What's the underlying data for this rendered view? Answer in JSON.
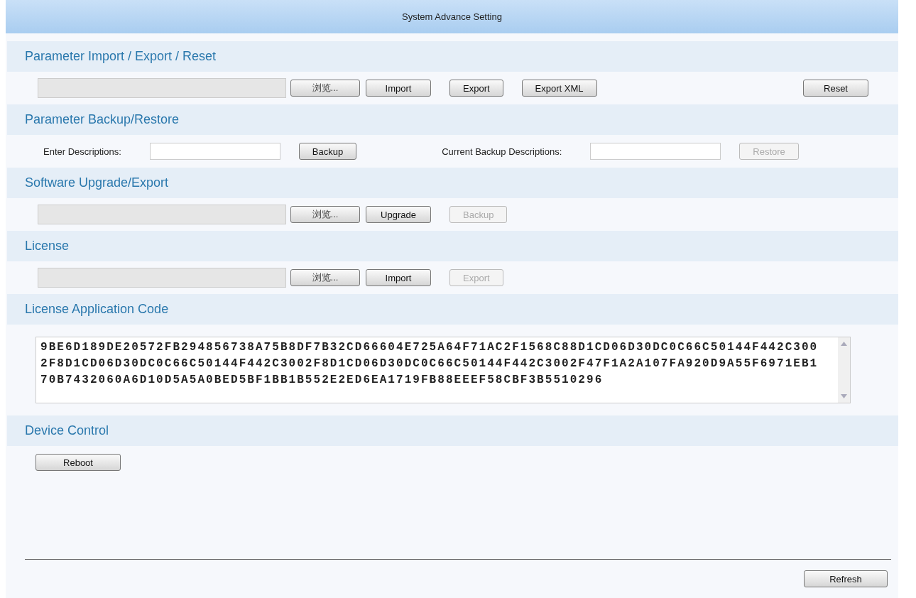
{
  "window": {
    "title": "System Advance Setting"
  },
  "sections": [
    {
      "title": "Parameter Import / Export / Reset",
      "items": [
        {
          "kind": "file",
          "browse": "浏览..."
        },
        {
          "kind": "button",
          "label": "Import",
          "disabled": false
        },
        {
          "kind": "button",
          "label": "Export",
          "disabled": false
        },
        {
          "kind": "button",
          "label": "Export XML",
          "disabled": false
        },
        {
          "kind": "button",
          "label": "Reset",
          "disabled": false
        }
      ]
    },
    {
      "title": "Parameter Backup/Restore",
      "items": [
        {
          "kind": "label",
          "text": "Enter Descriptions:"
        },
        {
          "kind": "input"
        },
        {
          "kind": "button",
          "label": "Backup",
          "disabled": false
        },
        {
          "kind": "label",
          "text": "Current Backup Descriptions:"
        },
        {
          "kind": "input"
        },
        {
          "kind": "button",
          "label": "Restore",
          "disabled": true
        }
      ]
    },
    {
      "title": "Software Upgrade/Export",
      "items": [
        {
          "kind": "file",
          "browse": "浏览..."
        },
        {
          "kind": "button",
          "label": "Upgrade",
          "disabled": false
        },
        {
          "kind": "button",
          "label": "Backup",
          "disabled": true
        }
      ]
    },
    {
      "title": "License",
      "items": [
        {
          "kind": "file",
          "browse": "浏览..."
        },
        {
          "kind": "button",
          "label": "Import",
          "disabled": false
        },
        {
          "kind": "button",
          "label": "Export",
          "disabled": true
        }
      ]
    },
    {
      "title": "License Application Code",
      "items": [
        {
          "kind": "textarea",
          "value": "9BE6D189DE20572FB294856738A75B8DF7B32CD66604E725A64F71AC2F1568C88D1CD06D30DC0C66C50144F442C3002F8D1CD06D30DC0C66C50144F442C3002F8D1CD06D30DC0C66C50144F442C3002F47F1A2A107FA920D9A55F6971EB170B7432060A6D10D5A5A0BED5BF1BB1B552E2ED6EA1719FB88EEEF58CBF3B5510296"
        }
      ]
    },
    {
      "title": "Device Control",
      "items": [
        {
          "kind": "button",
          "label": "Reboot",
          "disabled": false
        }
      ]
    }
  ],
  "footer": {
    "button": "Refresh"
  }
}
